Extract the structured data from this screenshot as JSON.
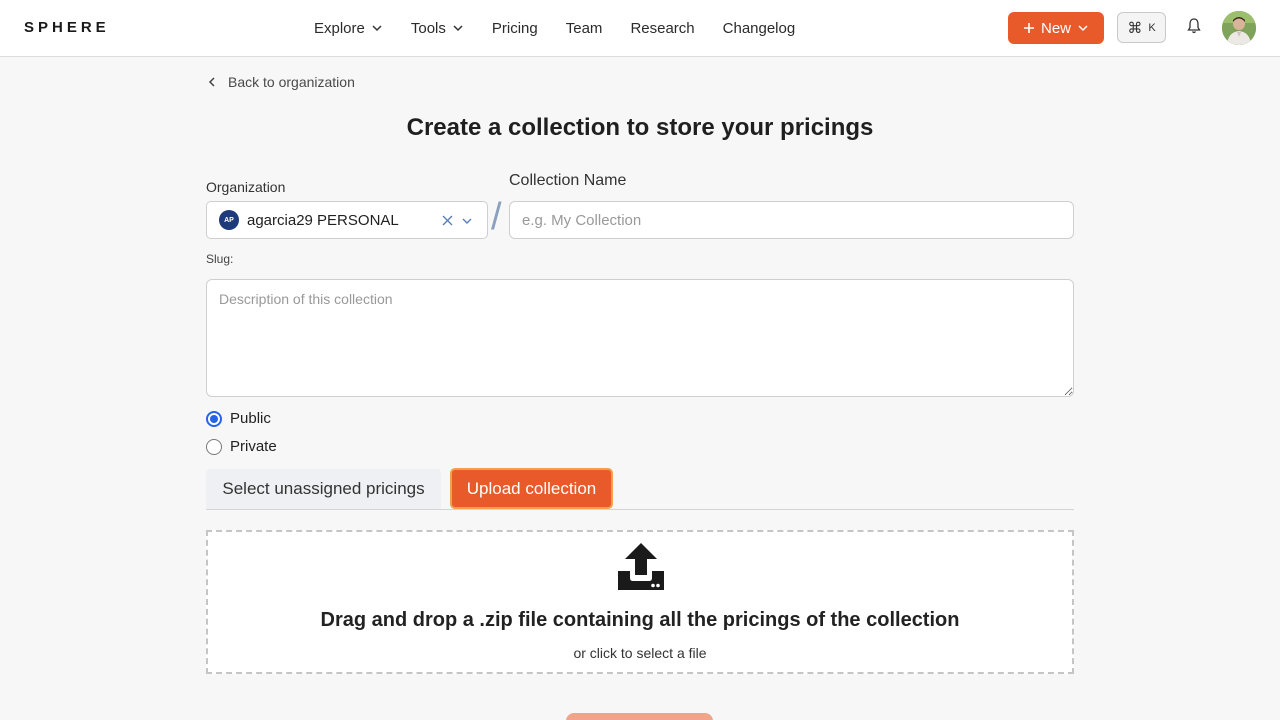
{
  "header": {
    "logo": "SPHERE",
    "nav": [
      {
        "label": "Explore",
        "dropdown": true
      },
      {
        "label": "Tools",
        "dropdown": true
      },
      {
        "label": "Pricing",
        "dropdown": false
      },
      {
        "label": "Team",
        "dropdown": false
      },
      {
        "label": "Research",
        "dropdown": false
      },
      {
        "label": "Changelog",
        "dropdown": false
      }
    ],
    "new_button": "New",
    "shortcut_symbol": "⌘",
    "shortcut_key": "K"
  },
  "back_link": "Back to organization",
  "title": "Create a collection to store your pricings",
  "organization": {
    "label": "Organization",
    "badge": "AP",
    "selected": "agarcia29 PERSONAL"
  },
  "collection_name": {
    "label": "Collection Name",
    "placeholder": "e.g. My Collection",
    "value": ""
  },
  "slug_label": "Slug:",
  "description": {
    "placeholder": "Description of this collection",
    "value": ""
  },
  "visibility": {
    "options": [
      {
        "label": "Public",
        "checked": true
      },
      {
        "label": "Private",
        "checked": false
      }
    ]
  },
  "tabs": {
    "select": "Select unassigned pricings",
    "upload": "Upload collection",
    "active": "upload"
  },
  "dropzone": {
    "title": "Drag and drop a .zip file containing all the pricings of the collection",
    "subtitle": "or click to select a file"
  },
  "colors": {
    "accent": "#e85a2a",
    "radio": "#2563eb"
  }
}
